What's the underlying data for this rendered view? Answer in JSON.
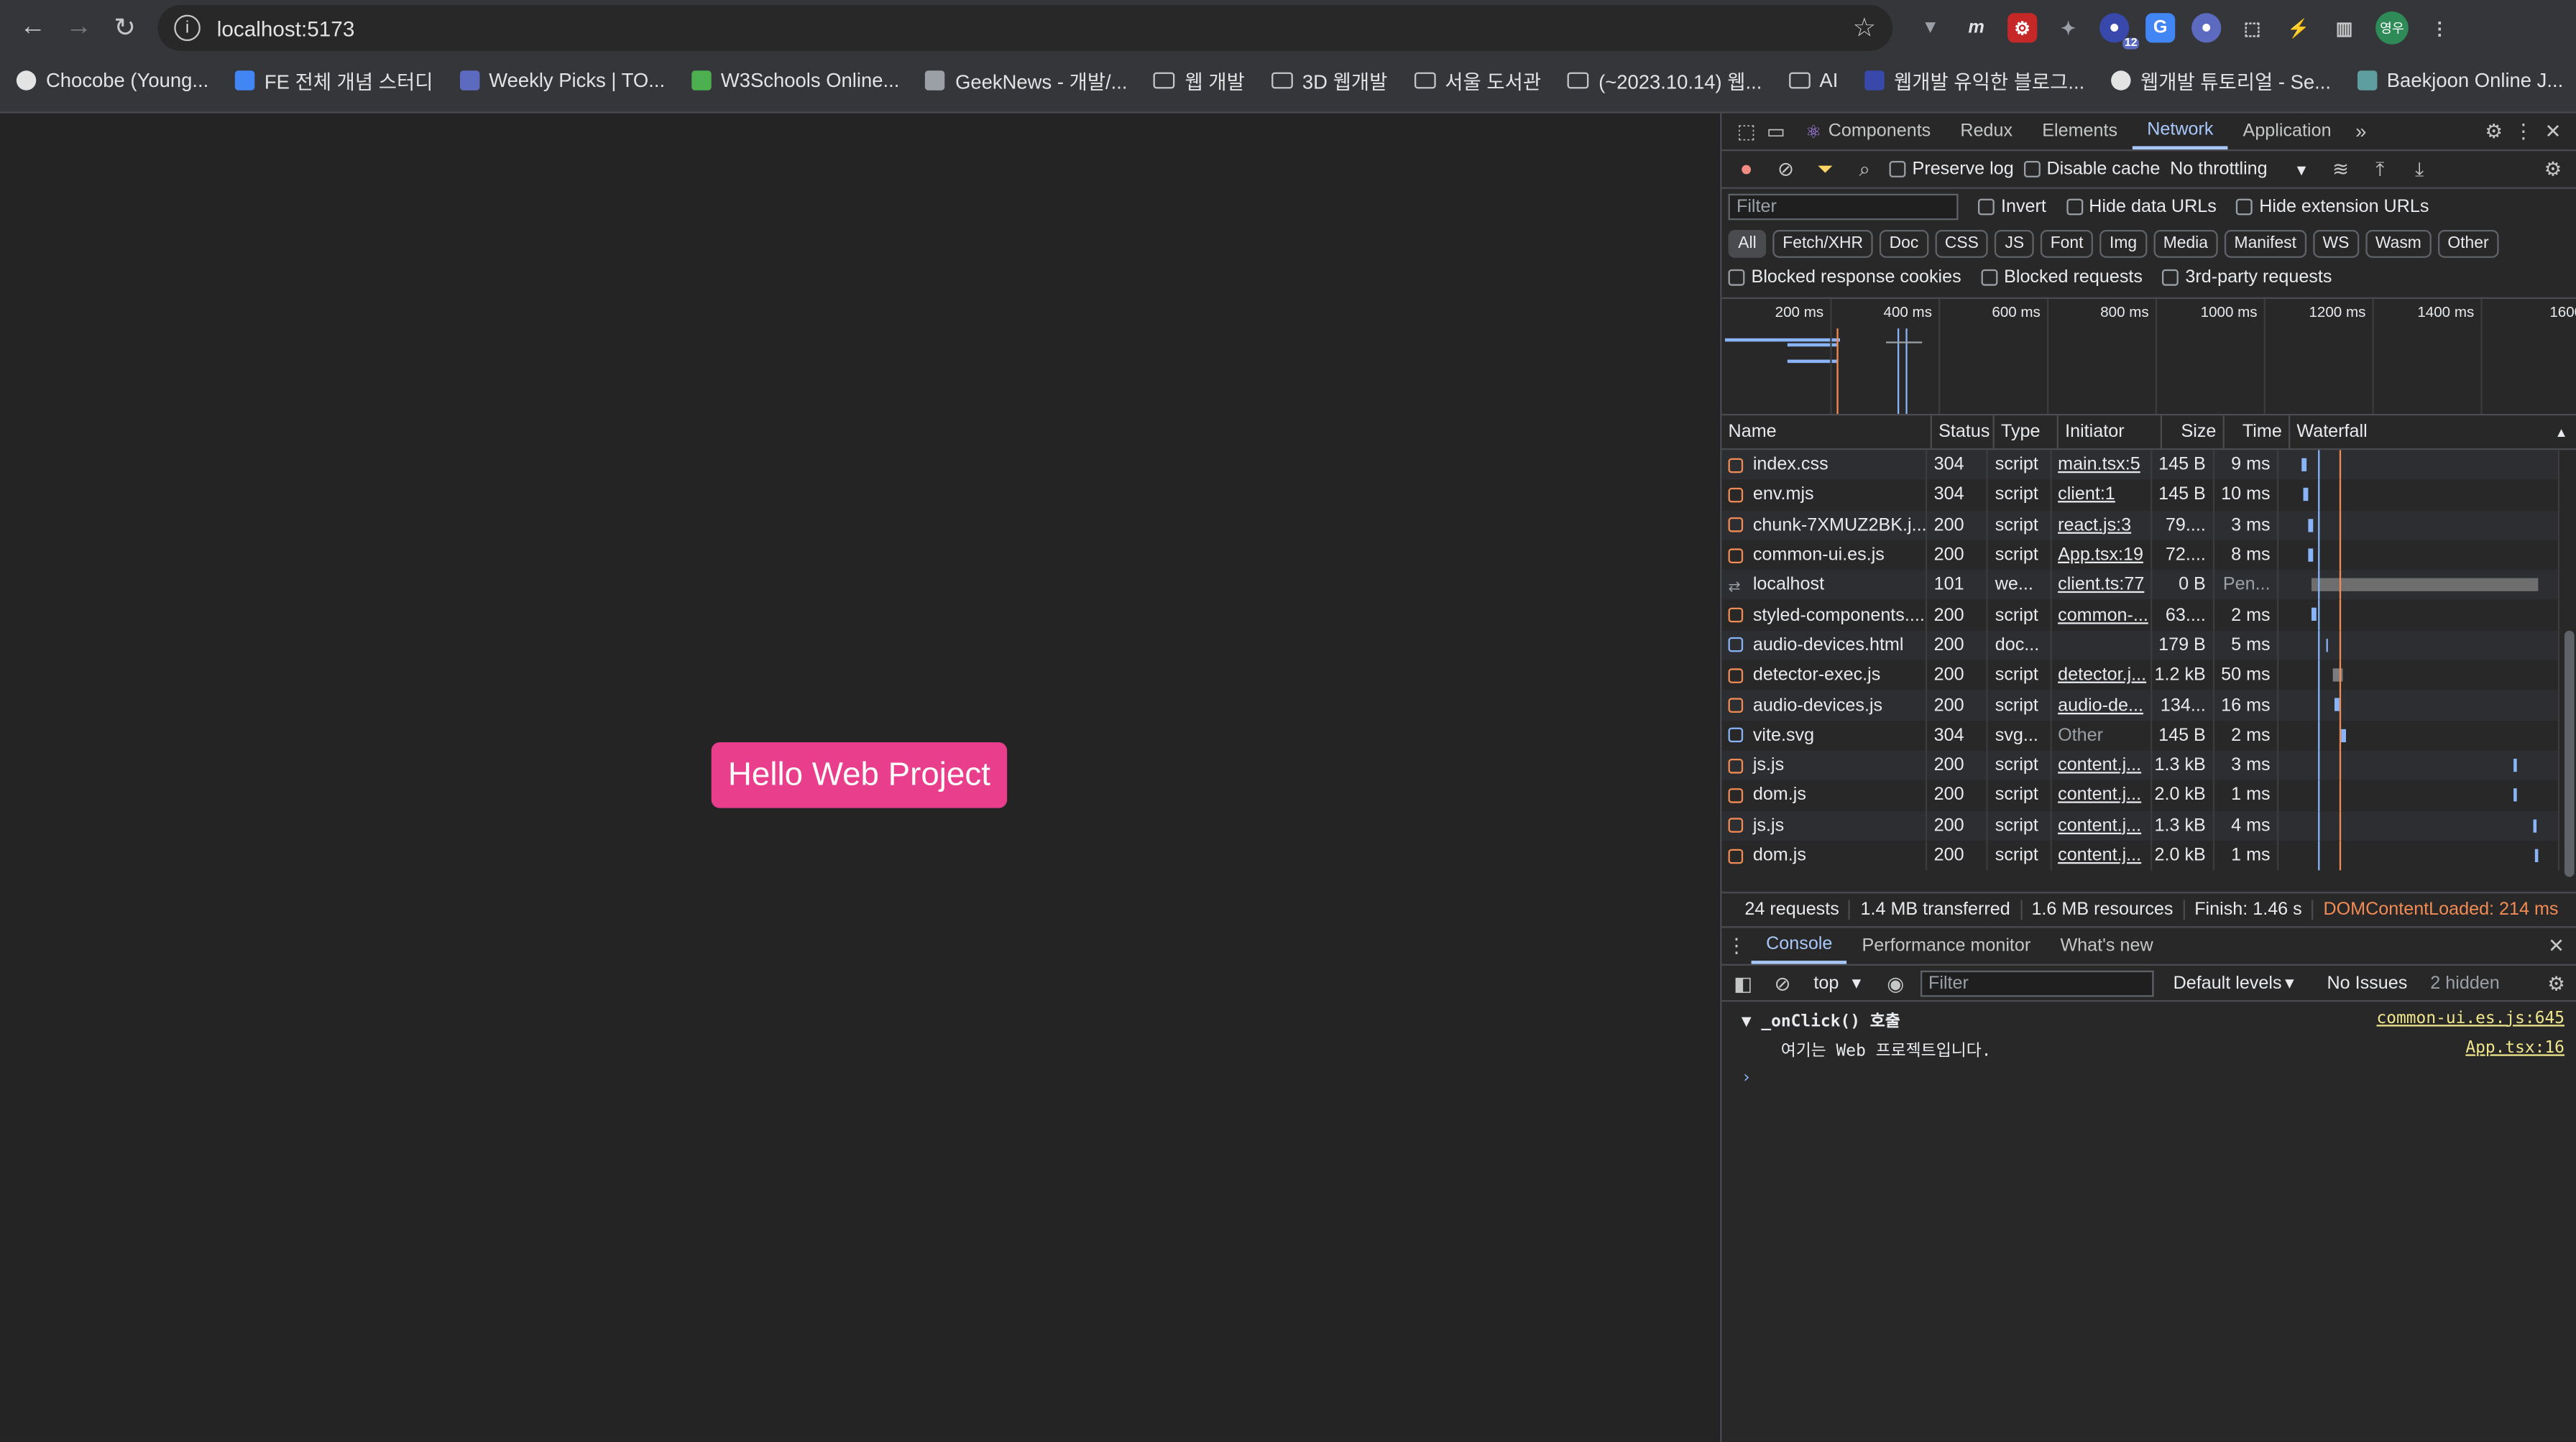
{
  "browser": {
    "url": "localhost:5173",
    "bookmarks": [
      {
        "label": "Chocobe (Young...",
        "icon": "github-icon"
      },
      {
        "label": "FE 전체 개념 스터디",
        "icon": "rocket-icon"
      },
      {
        "label": "Weekly Picks | TO...",
        "icon": "ui-icon"
      },
      {
        "label": "W3Schools Online...",
        "icon": "w3schools-icon"
      },
      {
        "label": "GeekNews - 개발/...",
        "icon": "geeknews-icon"
      },
      {
        "label": "웹 개발",
        "icon": "folder-icon"
      },
      {
        "label": "3D 웹개발",
        "icon": "folder-icon"
      },
      {
        "label": "서울 도서관",
        "icon": "folder-icon"
      },
      {
        "label": "(~2023.10.14) 웹...",
        "icon": "folder-icon"
      },
      {
        "label": "AI",
        "icon": "folder-icon"
      },
      {
        "label": "웹개발 유익한 블로그...",
        "icon": "blog-icon"
      },
      {
        "label": "웹개발 튜토리얼 - Se...",
        "icon": "globe-icon"
      },
      {
        "label": "Baekjoon Online J...",
        "icon": "code-icon"
      }
    ],
    "ext_badge": "12",
    "avatar_text": "영우"
  },
  "page": {
    "button_label": "Hello Web Project",
    "button_color": "#e83e8c"
  },
  "devtools": {
    "tabs": [
      "Components",
      "Redux",
      "Elements",
      "Network",
      "Application"
    ],
    "active_tab": "Network",
    "network": {
      "preserve_log": "Preserve log",
      "disable_cache": "Disable cache",
      "throttling": "No throttling",
      "filter_placeholder": "Filter",
      "invert": "Invert",
      "hide_data_urls": "Hide data URLs",
      "hide_ext_urls": "Hide extension URLs",
      "types": [
        "All",
        "Fetch/XHR",
        "Doc",
        "CSS",
        "JS",
        "Font",
        "Img",
        "Media",
        "Manifest",
        "WS",
        "Wasm",
        "Other"
      ],
      "blocked_cookies": "Blocked response cookies",
      "blocked_requests": "Blocked requests",
      "third_party": "3rd-party requests",
      "timeline_ticks": [
        "200 ms",
        "400 ms",
        "600 ms",
        "800 ms",
        "1000 ms",
        "1200 ms",
        "1400 ms",
        "1600"
      ],
      "columns": [
        "Name",
        "Status",
        "Type",
        "Initiator",
        "Size",
        "Time",
        "Waterfall"
      ],
      "rows": [
        {
          "name": "index.css",
          "status": "304",
          "type": "script",
          "initiator": "main.tsx:5",
          "size": "145 B",
          "time": "9 ms",
          "kind": "script"
        },
        {
          "name": "env.mjs",
          "status": "304",
          "type": "script",
          "initiator": "client:1",
          "size": "145 B",
          "time": "10 ms",
          "kind": "script"
        },
        {
          "name": "chunk-7XMUZ2BK.j...",
          "status": "200",
          "type": "script",
          "initiator": "react.js:3",
          "size": "79....",
          "time": "3 ms",
          "kind": "script"
        },
        {
          "name": "common-ui.es.js",
          "status": "200",
          "type": "script",
          "initiator": "App.tsx:19",
          "size": "72....",
          "time": "8 ms",
          "kind": "script"
        },
        {
          "name": "localhost",
          "status": "101",
          "type": "we...",
          "initiator": "client.ts:77",
          "size": "0 B",
          "time": "Pen...",
          "kind": "ws"
        },
        {
          "name": "styled-components....",
          "status": "200",
          "type": "script",
          "initiator": "common-...",
          "size": "63....",
          "time": "2 ms",
          "kind": "script"
        },
        {
          "name": "audio-devices.html",
          "status": "200",
          "type": "doc...",
          "initiator": "",
          "size": "179 B",
          "time": "5 ms",
          "kind": "doc"
        },
        {
          "name": "detector-exec.js",
          "status": "200",
          "type": "script",
          "initiator": "detector.j...",
          "size": "1.2 kB",
          "time": "50 ms",
          "kind": "script"
        },
        {
          "name": "audio-devices.js",
          "status": "200",
          "type": "script",
          "initiator": "audio-de...",
          "size": "134...",
          "time": "16 ms",
          "kind": "script"
        },
        {
          "name": "vite.svg",
          "status": "304",
          "type": "svg...",
          "initiator": "Other",
          "size": "145 B",
          "time": "2 ms",
          "kind": "doc"
        },
        {
          "name": "js.js",
          "status": "200",
          "type": "script",
          "initiator": "content.j...",
          "size": "1.3 kB",
          "time": "3 ms",
          "kind": "script"
        },
        {
          "name": "dom.js",
          "status": "200",
          "type": "script",
          "initiator": "content.j...",
          "size": "2.0 kB",
          "time": "1 ms",
          "kind": "script"
        },
        {
          "name": "js.js",
          "status": "200",
          "type": "script",
          "initiator": "content.j...",
          "size": "1.3 kB",
          "time": "4 ms",
          "kind": "script"
        },
        {
          "name": "dom.js",
          "status": "200",
          "type": "script",
          "initiator": "content.j...",
          "size": "2.0 kB",
          "time": "1 ms",
          "kind": "script"
        }
      ],
      "summary": {
        "requests": "24 requests",
        "transferred": "1.4 MB transferred",
        "resources": "1.6 MB resources",
        "finish": "Finish: 1.46 s",
        "dcl": "DOMContentLoaded: 214 ms"
      }
    },
    "drawer": {
      "tabs": [
        "Console",
        "Performance monitor",
        "What's new"
      ],
      "context": "top",
      "filter_placeholder": "Filter",
      "levels": "Default levels",
      "issues": "No Issues",
      "hidden": "2 hidden",
      "logs": [
        {
          "text": "▼ _onClick() 호출",
          "source": "common-ui.es.js:645"
        },
        {
          "text": "여기는 Web 프로젝트입니다.",
          "source": "App.tsx:16"
        }
      ],
      "prompt": "›"
    }
  }
}
